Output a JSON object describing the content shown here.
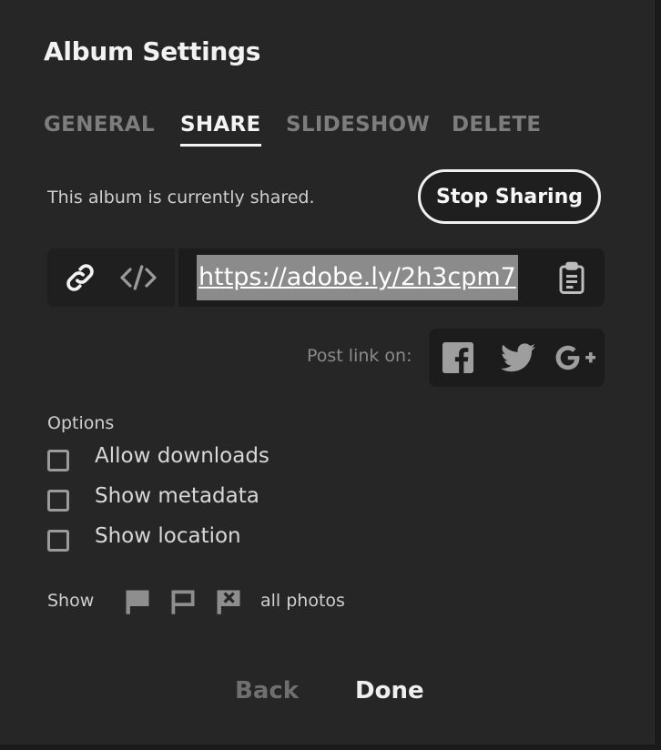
{
  "dialog": {
    "title": "Album Settings"
  },
  "tabs": [
    {
      "label": "GENERAL",
      "active": false
    },
    {
      "label": "SHARE",
      "active": true
    },
    {
      "label": "SLIDESHOW",
      "active": false
    },
    {
      "label": "DELETE",
      "active": false
    }
  ],
  "share": {
    "status_text": "This album is currently shared.",
    "stop_button": "Stop Sharing",
    "link_icons": [
      "link-icon",
      "embed-code-icon"
    ],
    "url": "https://adobe.ly/2h3cpm7",
    "clipboard_icon": "clipboard-icon",
    "post_link_label": "Post link on:",
    "social_icons": [
      "facebook-icon",
      "twitter-icon",
      "google-plus-icon"
    ]
  },
  "options": {
    "label": "Options",
    "items": [
      {
        "label": "Allow downloads",
        "checked": false
      },
      {
        "label": "Show metadata",
        "checked": false
      },
      {
        "label": "Show location",
        "checked": false
      }
    ]
  },
  "show_filter": {
    "label": "Show",
    "flag_icons": [
      "flagged-icon",
      "unflagged-icon",
      "rejected-icon"
    ],
    "value": "all photos"
  },
  "footer": {
    "back": "Back",
    "done": "Done"
  },
  "colors": {
    "background": "#262626",
    "text": "#eaeaea",
    "muted": "#7d7d7d",
    "accent": "#ffffff"
  }
}
